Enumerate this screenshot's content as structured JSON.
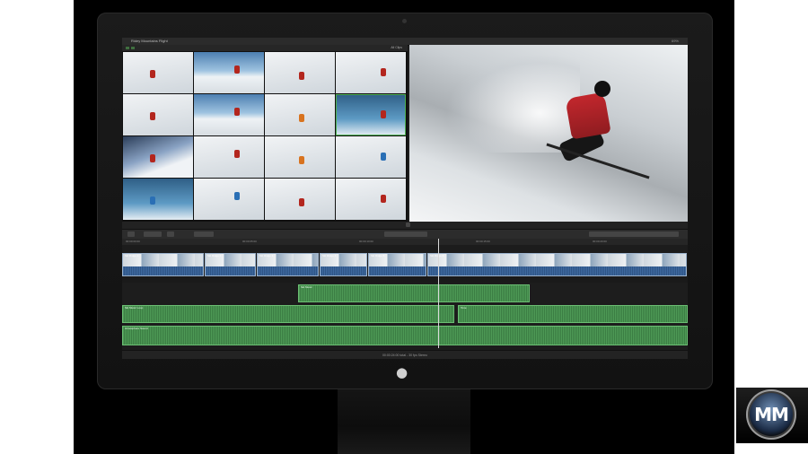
{
  "app": {
    "window_title": "Ridey Mountains Flight",
    "title_right": "69%"
  },
  "browser": {
    "filter_label": "All Clips",
    "thumbnails": [
      {
        "style": "snow",
        "skier": "red"
      },
      {
        "style": "sky",
        "skier": "red"
      },
      {
        "style": "snow",
        "skier": "red"
      },
      {
        "style": "snow",
        "skier": "red"
      },
      {
        "style": "snow",
        "skier": "red"
      },
      {
        "style": "sky",
        "skier": "red"
      },
      {
        "style": "snow",
        "skier": "orange"
      },
      {
        "style": "ice",
        "skier": "red",
        "selected": true
      },
      {
        "style": "dark",
        "skier": "red"
      },
      {
        "style": "snow",
        "skier": "red"
      },
      {
        "style": "snow",
        "skier": "orange"
      },
      {
        "style": "snow",
        "skier": "blue"
      },
      {
        "style": "ice",
        "skier": "blue"
      },
      {
        "style": "snow",
        "skier": "blue"
      },
      {
        "style": "snow",
        "skier": "red"
      },
      {
        "style": "snow",
        "skier": "red"
      }
    ]
  },
  "viewer": {
    "subject": "skier-red-jacket"
  },
  "timeline": {
    "ruler_ticks": [
      "00:00:00:00",
      "00:00:05:00",
      "00:00:10:00",
      "00:00:15:00",
      "00:00:20:00"
    ],
    "video_clips": [
      "Ski Ridge 1",
      "Ski Ridge 2",
      "Ski Ridge 3",
      "Ski Ridge 4",
      "Ski Ridge 5",
      "Ski Ridge 6"
    ],
    "audio_clips": [
      "Ski Music",
      "Ski Music Loop",
      "Narration",
      "Tone",
      "Atmosphere Sound"
    ]
  },
  "status": {
    "text": "00:00:24:00 total - 30 fps Stereo"
  },
  "logo": {
    "text": "MM"
  },
  "colors": {
    "accent": "#4caf50",
    "audio": "#4e9a56",
    "video_audio": "#3f6aa0"
  }
}
